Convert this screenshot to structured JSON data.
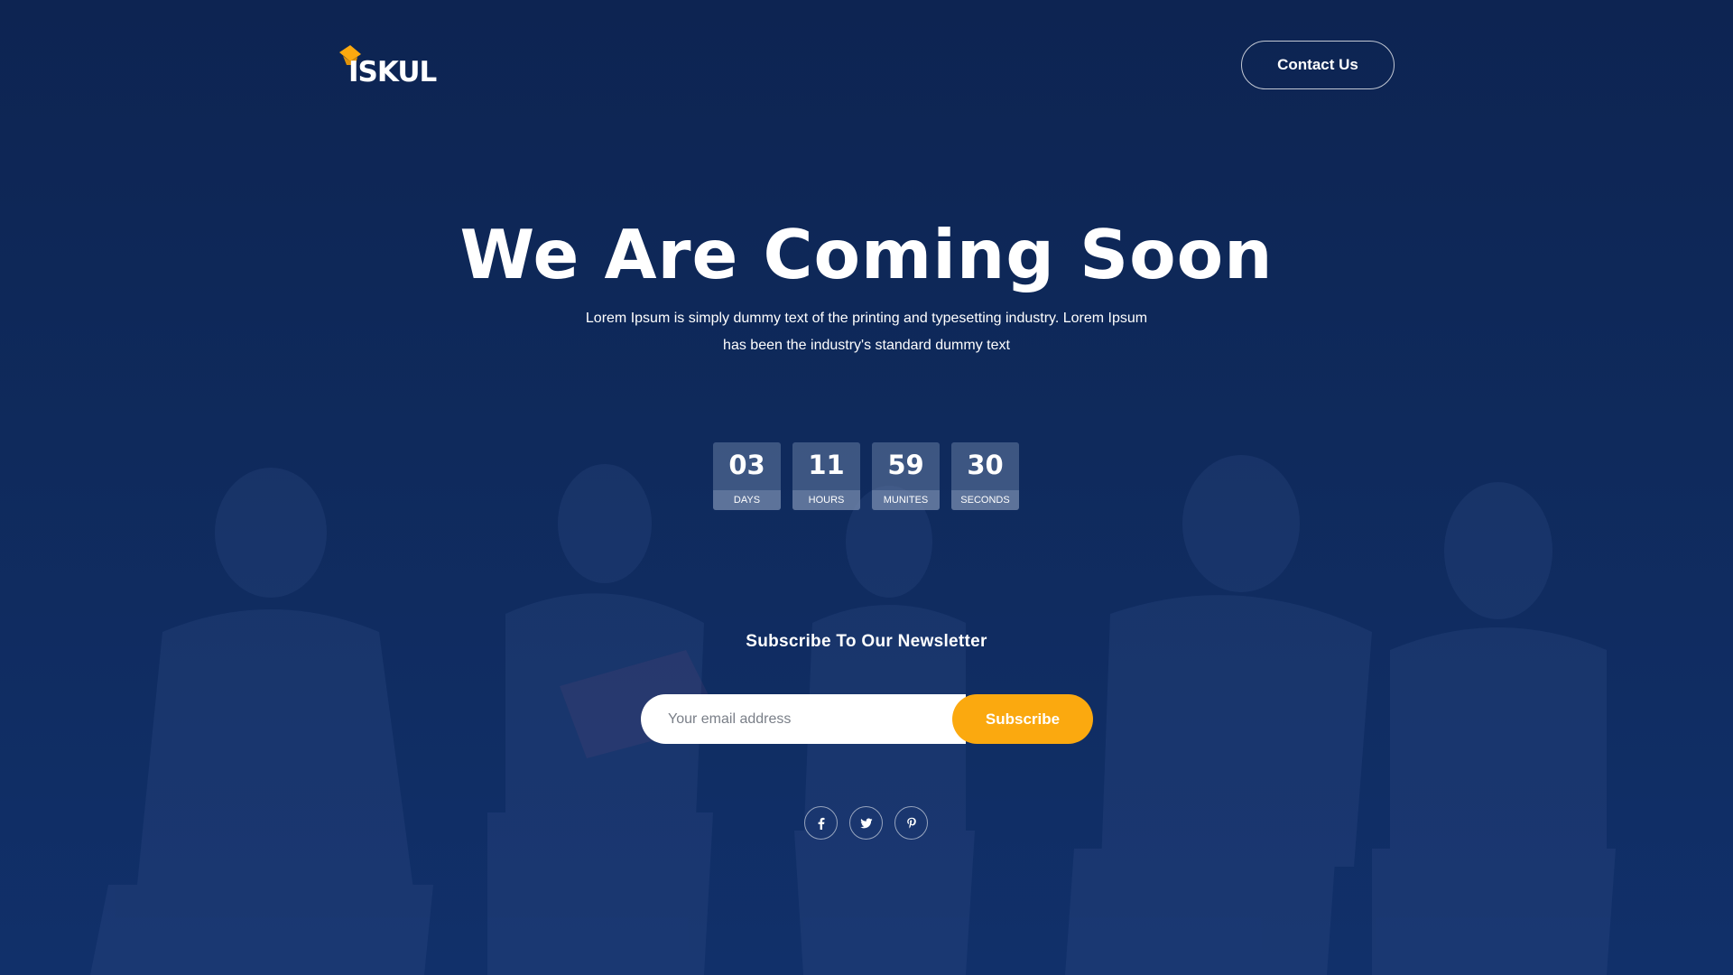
{
  "header": {
    "logo_text": "ISKUL",
    "contact_label": "Contact Us"
  },
  "hero": {
    "title": "We Are Coming Soon",
    "text_line1": "Lorem Ipsum is simply dummy text of the printing and typesetting industry. Lorem Ipsum",
    "text_line2": "has been the industry's standard dummy text"
  },
  "countdown": [
    {
      "value": "03",
      "label": "DAYS"
    },
    {
      "value": "11",
      "label": "HOURS"
    },
    {
      "value": "59",
      "label": "MUNITES"
    },
    {
      "value": "30",
      "label": "SECONDS"
    }
  ],
  "newsletter": {
    "title": "Subscribe To Our Newsletter",
    "email_placeholder": "Your email address",
    "subscribe_label": "Subscribe"
  },
  "social": [
    {
      "icon": "facebook-icon"
    },
    {
      "icon": "twitter-icon"
    },
    {
      "icon": "pinterest-icon"
    }
  ],
  "colors": {
    "background": "#0f2a5c",
    "accent": "#fba90f",
    "text": "#ffffff"
  }
}
